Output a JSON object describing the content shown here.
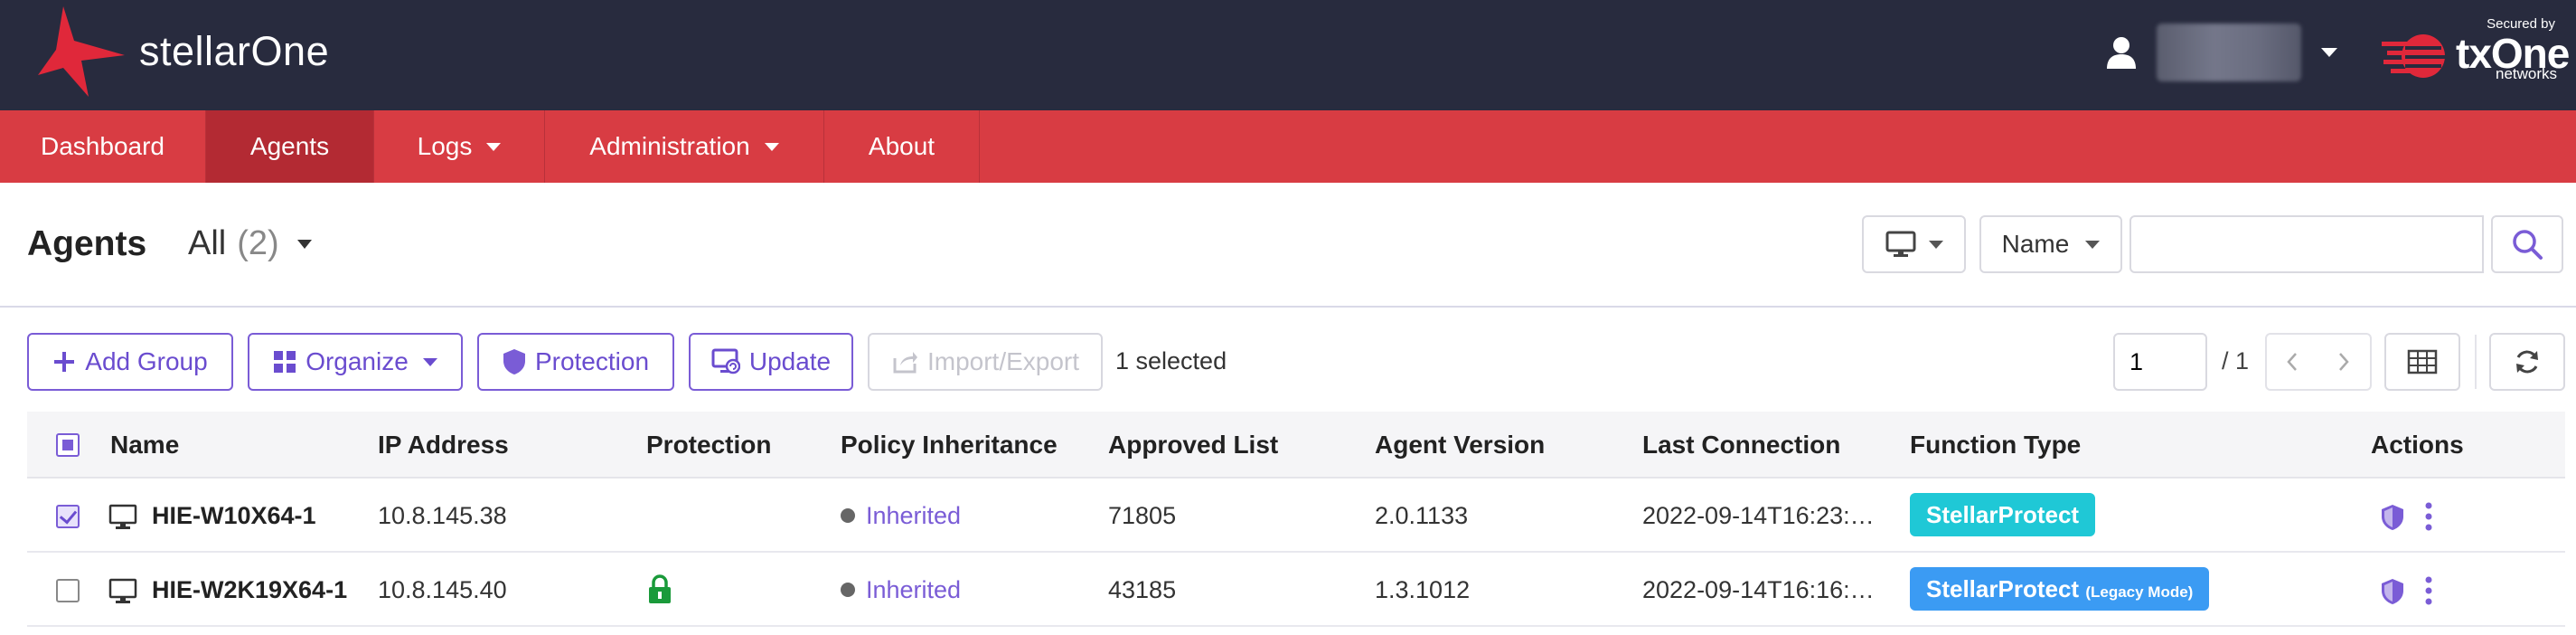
{
  "app": {
    "brand_name": "stellarOne",
    "vendor_secured": "Secured by",
    "vendor_name": "txOne",
    "vendor_sub": "networks"
  },
  "nav": {
    "items": [
      {
        "label": "Dashboard"
      },
      {
        "label": "Agents"
      },
      {
        "label": "Logs"
      },
      {
        "label": "Administration"
      },
      {
        "label": "About"
      }
    ],
    "active": "Agents"
  },
  "header": {
    "title": "Agents",
    "scope_label": "All",
    "scope_count": "(2)",
    "field_select": "Name",
    "search_value": ""
  },
  "toolbar": {
    "add_group": "Add Group",
    "organize": "Organize",
    "protection": "Protection",
    "update": "Update",
    "import_export": "Import/Export",
    "selected_text": "1 selected",
    "page_current": "1",
    "page_total": "/ 1"
  },
  "table": {
    "columns": [
      "Name",
      "IP Address",
      "Protection",
      "Policy Inheritance",
      "Approved List",
      "Agent Version",
      "Last Connection",
      "Function Type",
      "Actions"
    ],
    "rows": [
      {
        "checked": true,
        "name": "HIE-W10X64-1",
        "ip": "10.8.145.38",
        "protection": "",
        "policy": "Inherited",
        "approved": "71805",
        "version": "2.0.1133",
        "last_connection": "2022-09-14T16:23:…",
        "function_type": "StellarProtect",
        "function_suffix": ""
      },
      {
        "checked": false,
        "name": "HIE-W2K19X64-1",
        "ip": "10.8.145.40",
        "protection": "lock-icon",
        "policy": "Inherited",
        "approved": "43185",
        "version": "1.3.1012",
        "last_connection": "2022-09-14T16:16:…",
        "function_type": "StellarProtect",
        "function_suffix": "(Legacy Mode)"
      }
    ]
  },
  "colors": {
    "header_bg": "#282b3e",
    "nav_bg": "#d83c43",
    "nav_active": "#b32a33",
    "accent": "#7a5cd6",
    "badge_cyan": "#1fc8d6",
    "badge_blue": "#3b9bf3",
    "lock_green": "#1a9a3a"
  }
}
